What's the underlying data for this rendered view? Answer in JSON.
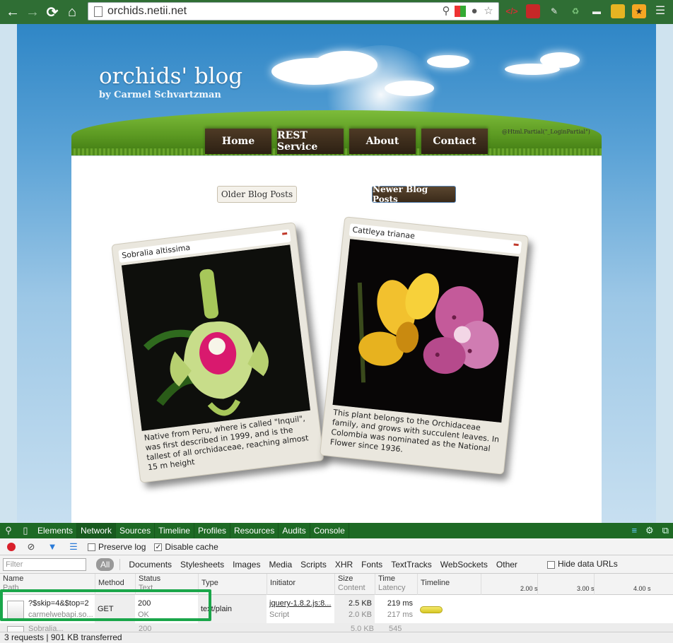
{
  "browser": {
    "url": "orchids.netii.net",
    "nav": {
      "back": "←",
      "forward": "→",
      "reload": "⟳",
      "home": "⌂"
    },
    "icons": [
      "zoom-icon",
      "favicon-icon",
      "bulb-icon",
      "star-icon"
    ],
    "extensions": [
      "code-extension-icon",
      "bookmark-extension-icon",
      "pen-extension-icon",
      "recycle-extension-icon",
      "download-extension-icon",
      "ruler-extension-icon",
      "translate-extension-icon",
      "menu-icon"
    ]
  },
  "site": {
    "title": "orchids' blog",
    "subtitle": "by Carmel Schvartzman",
    "menu": [
      "Home",
      "REST Service",
      "About",
      "Contact"
    ],
    "login_partial": "@Html.Partial(\"_LoginPartial\")",
    "older_button": "Older Blog Posts",
    "newer_button": "Newer Blog Posts",
    "posts": [
      {
        "title": "Sobralia altissima",
        "text": "Native from Peru, where is called \"Inquil\", was first described in 1999, and is the tallest of all orchidaceae, reaching almost 15 m height"
      },
      {
        "title": "Cattleya trianae",
        "text": "This plant belongs to the Orchidaceae family, and grows with succulent leaves. In Colombia was nominated as the National Flower since 1936."
      }
    ]
  },
  "devtools": {
    "tabs": [
      "Elements",
      "Network",
      "Sources",
      "Timeline",
      "Profiles",
      "Resources",
      "Audits",
      "Console"
    ],
    "active_tab": "Network",
    "preserve_log": "Preserve log",
    "disable_cache": "Disable cache",
    "filter_placeholder": "Filter",
    "filters": [
      "All",
      "Documents",
      "Stylesheets",
      "Images",
      "Media",
      "Scripts",
      "XHR",
      "Fonts",
      "TextTracks",
      "WebSockets",
      "Other"
    ],
    "hide_data_urls": "Hide data URLs",
    "columns": {
      "name": "Name",
      "path": "Path",
      "method": "Method",
      "status": "Status",
      "text": "Text",
      "type": "Type",
      "initiator": "Initiator",
      "size": "Size",
      "content": "Content",
      "time": "Time",
      "latency": "Latency",
      "timeline": "Timeline"
    },
    "ticks": [
      "2.00 s",
      "3.00 s",
      "4.00 s"
    ],
    "rows": [
      {
        "name": "?$skip=4&$top=2",
        "path": "carmelwebapi.so...",
        "method": "GET",
        "status": "200",
        "status_text": "OK",
        "type": "text/plain",
        "initiator": "jquery-1.8.2.js:8...",
        "initiator_type": "Script",
        "size": "2.5 KB",
        "content": "2.0 KB",
        "time": "219 ms",
        "latency": "217 ms"
      },
      {
        "name": "Sobralia...",
        "status": "200",
        "size": "5.0 KB",
        "time": "545"
      }
    ],
    "status_bar": "3 requests | 901 KB transferred"
  }
}
